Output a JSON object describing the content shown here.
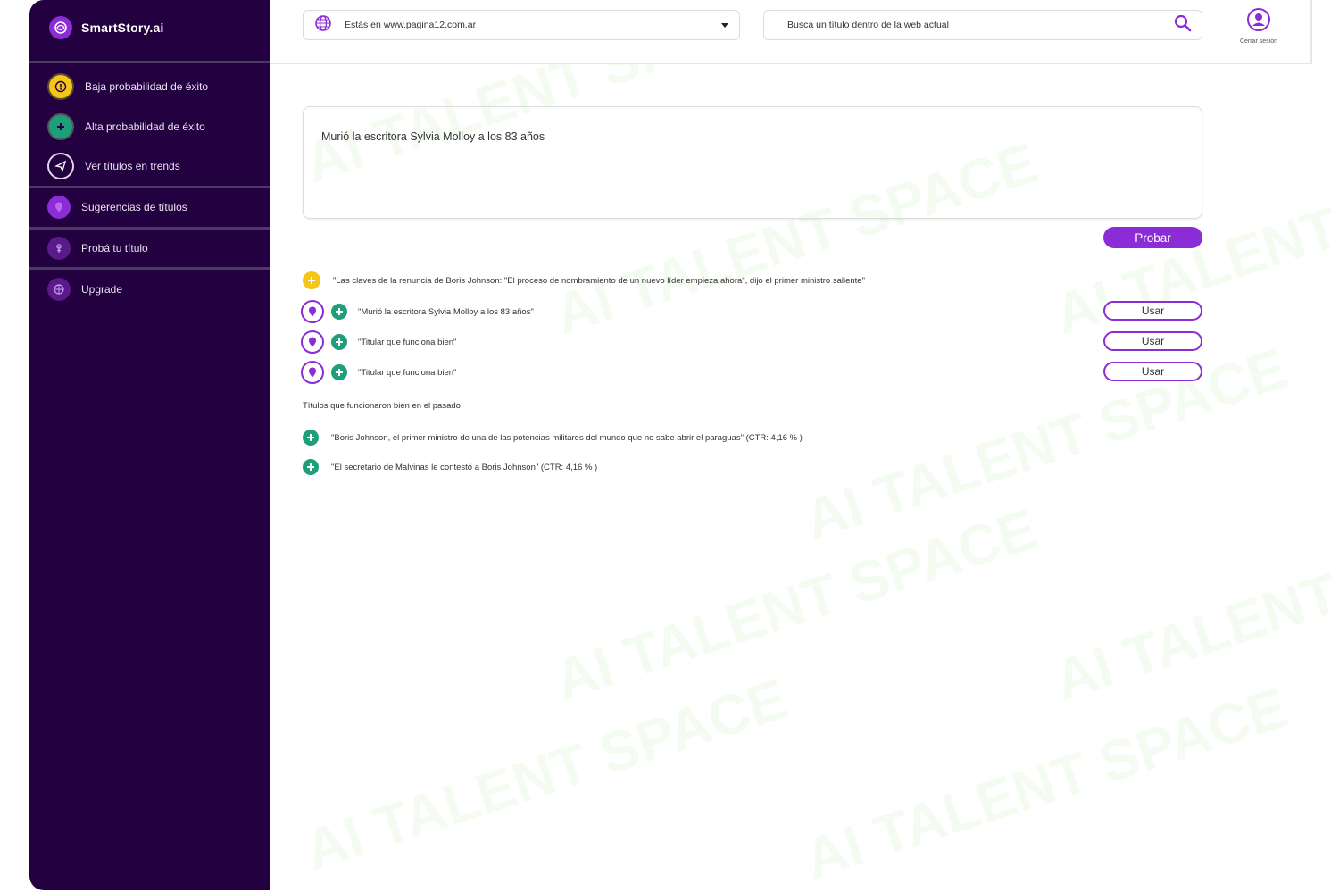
{
  "sidebar": {
    "brand": "SmartStory.ai",
    "items": [
      {
        "label": "Baja probabilidad de éxito",
        "icon": "warning-icon"
      },
      {
        "label": "Alta probabilidad de éxito",
        "icon": "plus-badge-icon"
      },
      {
        "label": "Ver títulos en trends",
        "icon": "send-icon"
      },
      {
        "label": "Sugerencias de títulos",
        "icon": "pin-icon"
      },
      {
        "label": "Probá tu título",
        "icon": "tap-icon"
      },
      {
        "label": "Upgrade",
        "icon": "globe-icon"
      }
    ]
  },
  "header": {
    "site_selector": "Estás en www.pagina12.com.ar",
    "search_placeholder": "Busca un título dentro de la web actual",
    "logout_label": "Cerrar sesión"
  },
  "main": {
    "title_input": "Murió la escritora Sylvia Molloy a los 83 años",
    "probar_label": "Probar",
    "warning_result": "\"Las claves de la renuncia de Boris Johnson: \"El proceso de nombramiento de un nuevo líder empieza ahora\", dijo el primer ministro saliente\"",
    "suggestions": [
      {
        "text": "\"Murió la escritora  Sylvia Molloy a los 83 años\"",
        "button": "Usar"
      },
      {
        "text": "\"Titular que funciona bien\"",
        "button": "Usar"
      },
      {
        "text": "\"Titular que funciona bien\"",
        "button": "Usar"
      }
    ],
    "past_section_title": "Títulos que funcionaron bien en el pasado",
    "past_titles": [
      "\"Boris Johnson, el primer ministro de una de las potencias militares del mundo que no sabe abrir el paraguas\" (CTR: 4,16 % )",
      "\"El secretario de Malvinas le contestó a Boris Johnson\" (CTR: 4,16 % )"
    ]
  },
  "watermark": "AI TALENT SPACE",
  "colors": {
    "sidebar_bg": "#23003f",
    "accent_purple": "#8b2cd6",
    "success_green": "#1f9e7a",
    "warning_yellow": "#f5c518"
  }
}
